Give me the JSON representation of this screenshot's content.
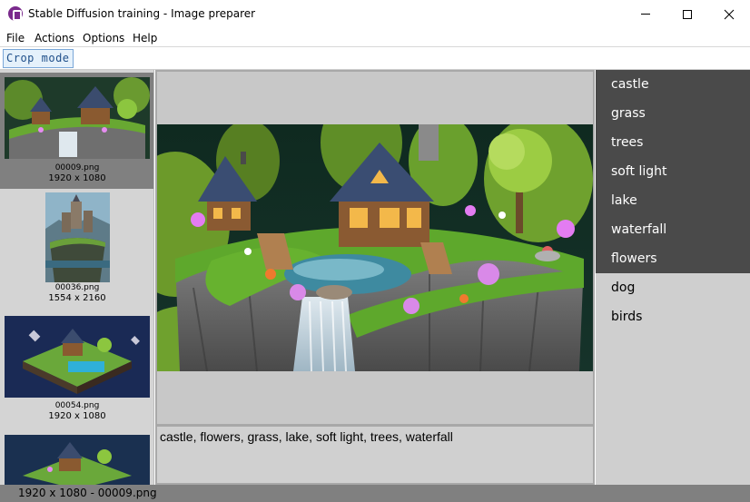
{
  "window": {
    "title": "Stable Diffusion training - Image preparer",
    "icon": "app-icon"
  },
  "menu": {
    "file": "File",
    "actions": "Actions",
    "options": "Options",
    "help": "Help"
  },
  "toolbar": {
    "crop_mode": "Crop mode"
  },
  "thumbnails": [
    {
      "name": "00009.png",
      "size": "1920 x 1080",
      "selected": true
    },
    {
      "name": "00036.png",
      "size": "1554 x 2160",
      "selected": false
    },
    {
      "name": "00054.png",
      "size": "1920 x 1080",
      "selected": false
    },
    {
      "name": "",
      "size": "",
      "selected": false
    }
  ],
  "caption": "castle, flowers, grass, lake, soft light, trees, waterfall",
  "tags": [
    {
      "label": "castle",
      "active": true
    },
    {
      "label": "grass",
      "active": true
    },
    {
      "label": "trees",
      "active": true
    },
    {
      "label": "soft light",
      "active": true
    },
    {
      "label": "lake",
      "active": true
    },
    {
      "label": "waterfall",
      "active": true
    },
    {
      "label": "flowers",
      "active": true
    },
    {
      "label": "dog",
      "active": false
    },
    {
      "label": "birds",
      "active": false
    }
  ],
  "status": "1920 x 1080 - 00009.png",
  "colors": {
    "tag_active_bg": "#4a4a4a",
    "tag_inactive_bg": "#cfcfcf",
    "thumb_selected_bg": "#808080",
    "status_bg": "#808080"
  }
}
